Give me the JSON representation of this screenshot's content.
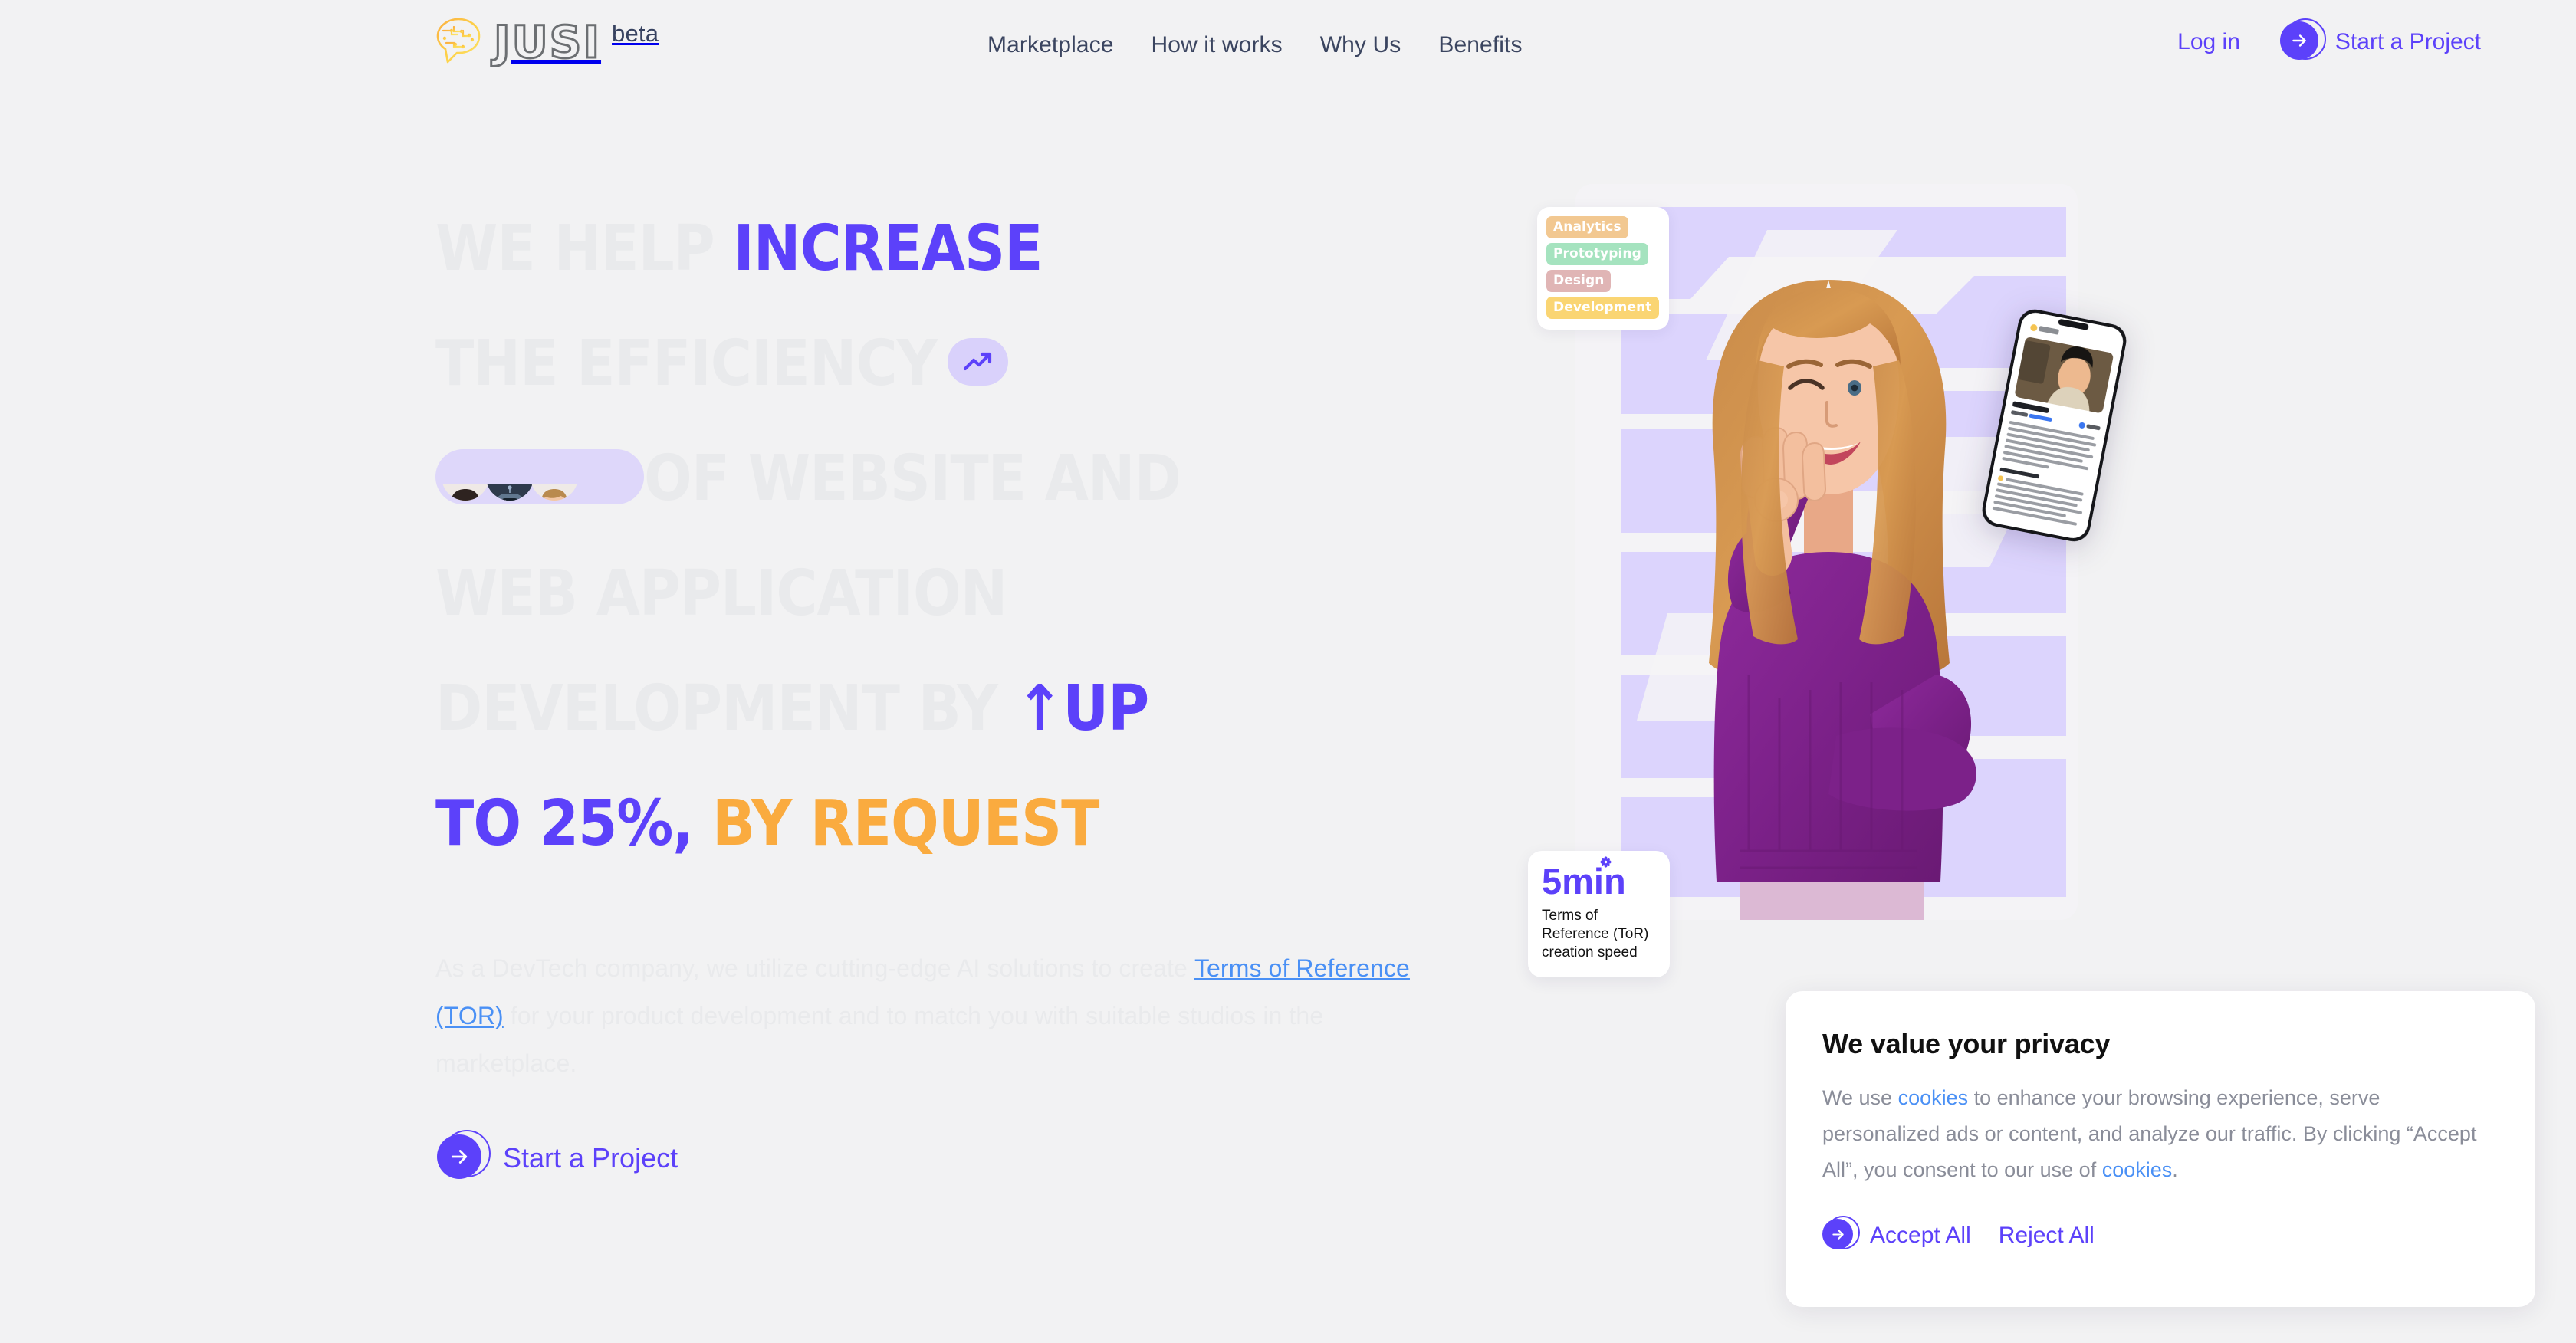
{
  "brand": {
    "name": "JUSI",
    "badge": "beta",
    "icon": "brain-speech-bubble-logo"
  },
  "nav": {
    "items": [
      {
        "label": "Marketplace"
      },
      {
        "label": "How it works"
      },
      {
        "label": "Why Us"
      },
      {
        "label": "Benefits"
      }
    ]
  },
  "header_actions": {
    "login_label": "Log in",
    "cta_label": "Start a Project",
    "cta_icon": "arrow-right-icon"
  },
  "hero": {
    "headline": {
      "line1_ghost": "WE HELP ",
      "line1_accent": "INCREASE",
      "line2_ghost": "THE EFFICIENCY",
      "line2_icon": "trending-up-icon",
      "line3_ghost": "OF WEBSITE AND",
      "line3_icon": "avatar-group-icon",
      "line4_ghost": "WEB APPLICATION",
      "line5_ghost": "DEVELOPMENT BY ",
      "line5_accent": "↑UP",
      "line6_accent_purple": "TO 25%,",
      "line6_accent_orange": " BY REQUEST"
    },
    "paragraph": {
      "part1": "As a DevTech company, we utilize cutting-edge AI solutions to create ",
      "link": "Terms of Reference (TOR)",
      "part2": " for your product development and to match you with suitable studios in the marketplace."
    },
    "cta_label": "Start a Project",
    "cta_icon": "arrow-right-icon"
  },
  "hero_visual": {
    "tags": [
      {
        "label": "Analytics",
        "color": "#f2c891"
      },
      {
        "label": "Prototyping",
        "color": "#a5e3bf"
      },
      {
        "label": "Design",
        "color": "#e0b5b5"
      },
      {
        "label": "Development",
        "color": "#fad573"
      }
    ],
    "speed_card": {
      "value": "5min",
      "description": "Terms of Reference (ToR) creation speed",
      "icon": "ai-flower-icon"
    },
    "photo_alt": "woman-ok-gesture-photo",
    "phone_alt": "phone-profile-mockup"
  },
  "cookie_banner": {
    "title": "We value your privacy",
    "body_part1": "We use ",
    "link1": "cookies",
    "body_part2": " to enhance your browsing experience, serve personalized ads or content, and analyze our traffic. By clicking “Accept All”, you consent to our use of ",
    "link2": "cookies",
    "body_part3": ".",
    "accept_label": "Accept All",
    "reject_label": "Reject All",
    "accept_icon": "arrow-right-icon"
  },
  "colors": {
    "page_bg": "#f2f2f3",
    "accent_purple": "#5c41fa",
    "accent_orange": "#faab3f",
    "ghost_text": "#e9eaec",
    "nav_text": "#3b4560",
    "link_blue": "#4a90f5",
    "lavender": "#dcd4fd"
  }
}
